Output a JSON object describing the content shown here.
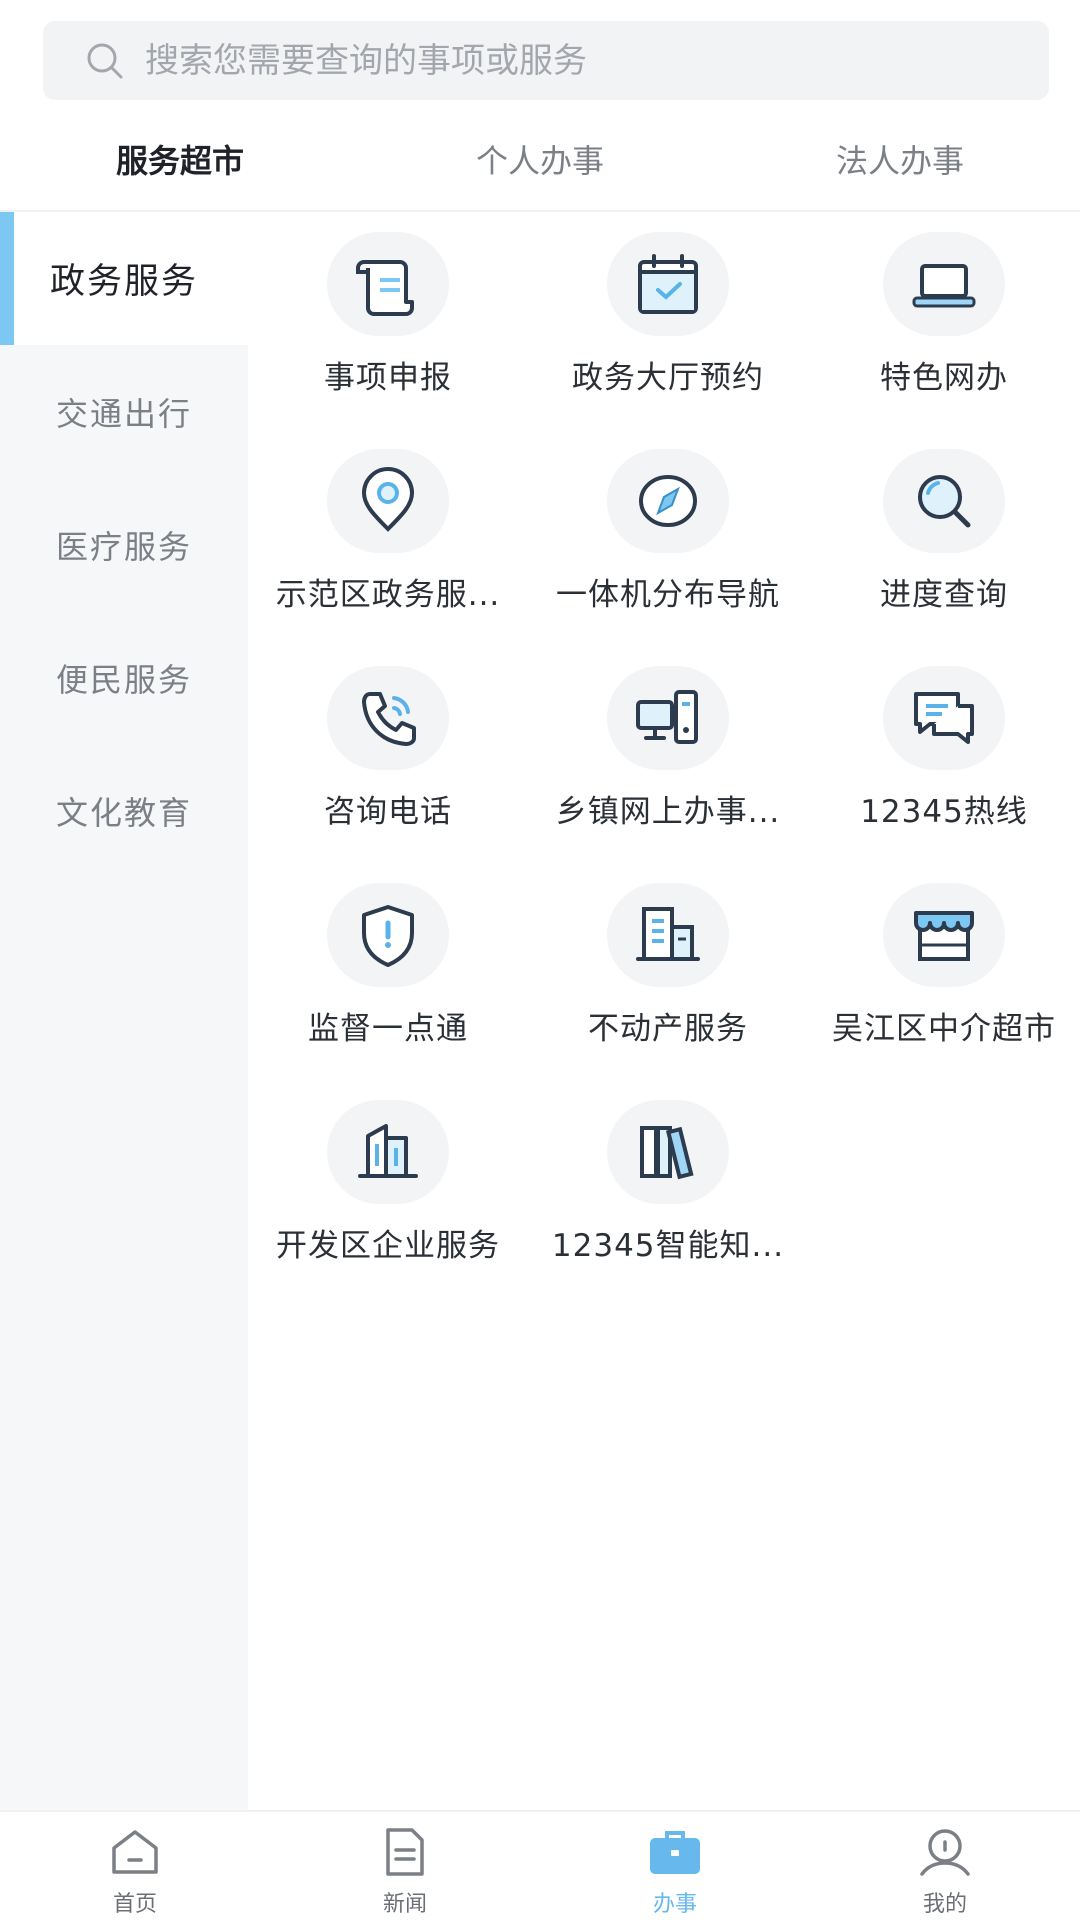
{
  "search": {
    "placeholder": "搜索您需要查询的事项或服务",
    "icon": "search-icon"
  },
  "tabs": [
    {
      "label": "服务超市",
      "active": true
    },
    {
      "label": "个人办事",
      "active": false
    },
    {
      "label": "法人办事",
      "active": false
    }
  ],
  "sidebar": {
    "items": [
      {
        "label": "政务服务",
        "active": true
      },
      {
        "label": "交通出行",
        "active": false
      },
      {
        "label": "医疗服务",
        "active": false
      },
      {
        "label": "便民服务",
        "active": false
      },
      {
        "label": "文化教育",
        "active": false
      }
    ]
  },
  "services": [
    {
      "label": "事项申报",
      "icon": "scroll-icon"
    },
    {
      "label": "政务大厅预约",
      "icon": "calendar-icon"
    },
    {
      "label": "特色网办",
      "icon": "laptop-icon"
    },
    {
      "label": "示范区政务服...",
      "icon": "location-pin-icon"
    },
    {
      "label": "一体机分布导航",
      "icon": "compass-icon"
    },
    {
      "label": "进度查询",
      "icon": "magnifier-icon"
    },
    {
      "label": "咨询电话",
      "icon": "phone-icon"
    },
    {
      "label": "乡镇网上办事...",
      "icon": "computer-icon"
    },
    {
      "label": "12345热线",
      "icon": "chat-icon"
    },
    {
      "label": "监督一点通",
      "icon": "shield-icon"
    },
    {
      "label": "不动产服务",
      "icon": "building-icon"
    },
    {
      "label": "吴江区中介超市",
      "icon": "store-icon"
    },
    {
      "label": "开发区企业服务",
      "icon": "office-tower-icon"
    },
    {
      "label": "12345智能知...",
      "icon": "books-icon"
    }
  ],
  "bottom_nav": [
    {
      "label": "首页",
      "icon": "home-icon",
      "active": false
    },
    {
      "label": "新闻",
      "icon": "document-icon",
      "active": false
    },
    {
      "label": "办事",
      "icon": "briefcase-icon",
      "active": true
    },
    {
      "label": "我的",
      "icon": "user-icon",
      "active": false
    }
  ],
  "colors": {
    "accent": "#7cc8f3",
    "active_nav": "#67b8ec",
    "icon_stroke": "#2d3b4e"
  }
}
